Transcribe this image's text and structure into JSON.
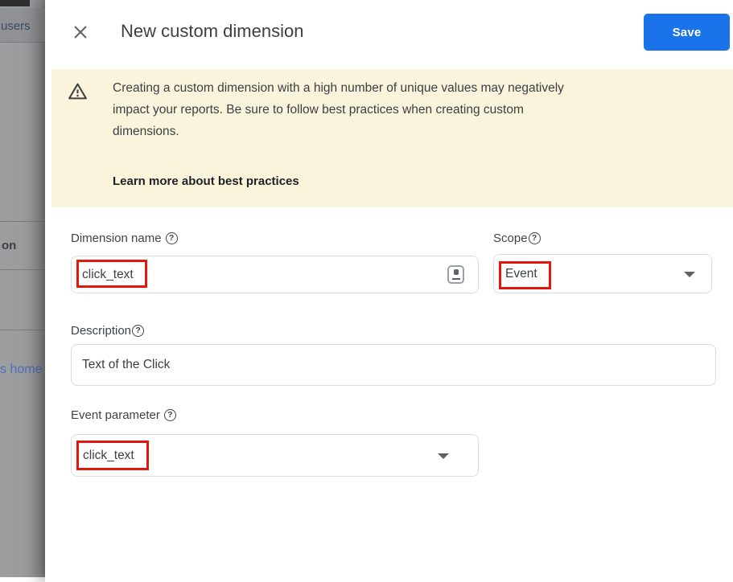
{
  "background_page": {
    "partial_text_users": "users",
    "partial_text_on": "on",
    "partial_link_home": "s home"
  },
  "dialog": {
    "title": "New custom dimension",
    "save_label": "Save",
    "help_glyph": "?",
    "banner": {
      "lines": [
        "Creating a custom dimension with a high number of unique values may negatively",
        "impact your reports. Be sure to follow best practices when creating custom",
        "dimensions."
      ],
      "link_label": "Learn more about best practices"
    },
    "fields": {
      "dimension_name": {
        "label": "Dimension name",
        "value": "click_text"
      },
      "scope": {
        "label": "Scope",
        "value": "Event"
      },
      "description": {
        "label": "Description",
        "value": "Text of the Click"
      },
      "event_parameter": {
        "label": "Event parameter",
        "value": "click_text"
      }
    }
  },
  "colors": {
    "accent_blue": "#1a73e8",
    "banner_bg": "#fbf4dc",
    "border_gray": "#dadce0",
    "icon_gray": "#5f6368",
    "backdrop_gray": "#9a9b9d",
    "dimmed_link_blue": "#4e6dbd",
    "annotation_red": "#e3170b"
  }
}
